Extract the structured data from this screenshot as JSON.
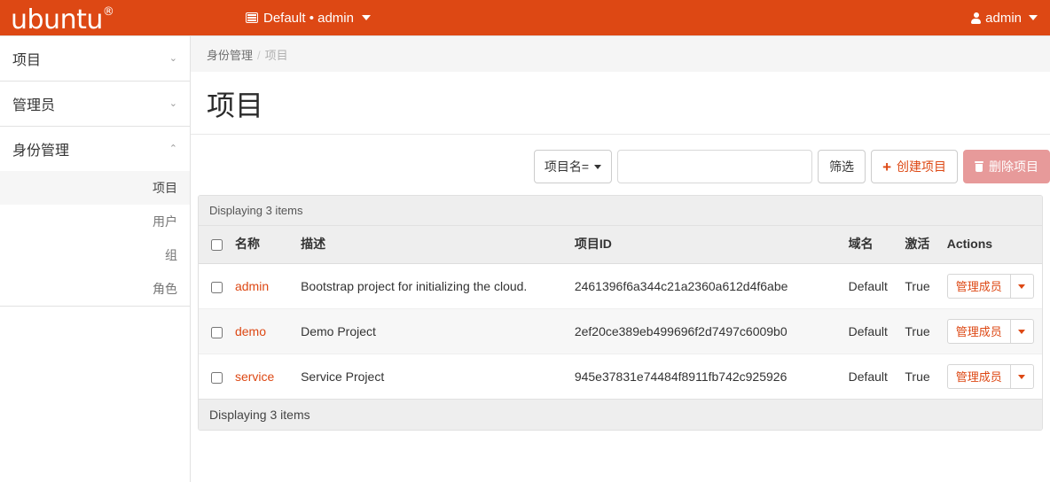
{
  "topbar": {
    "brand": "ubuntu",
    "brand_sup": "®",
    "context_icon": "grid-icon",
    "context_label": "Default • admin",
    "user_icon": "user-icon",
    "user_label": "admin",
    "bg_color": "#dd4814"
  },
  "sidebar": {
    "groups": [
      {
        "label": "项目",
        "chevron": "⌄",
        "expanded": false,
        "items": []
      },
      {
        "label": "管理员",
        "chevron": "⌄",
        "expanded": false,
        "items": []
      },
      {
        "label": "身份管理",
        "chevron": "⌃",
        "expanded": true,
        "items": [
          {
            "label": "项目",
            "active": true
          },
          {
            "label": "用户",
            "active": false
          },
          {
            "label": "组",
            "active": false
          },
          {
            "label": "角色",
            "active": false
          }
        ]
      }
    ]
  },
  "breadcrumb": {
    "parent": "身份管理",
    "separator": "/",
    "current": "项目"
  },
  "page": {
    "title": "项目"
  },
  "toolbar": {
    "filter_select_label": "项目名=",
    "filter_input_value": "",
    "filter_input_placeholder": "",
    "filter_button": "筛选",
    "create_button": "创建项目",
    "create_plus": "+",
    "delete_button": "删除项目",
    "delete_icon": "trash-icon",
    "create_color": "#dd4814",
    "delete_bg_color": "#e79a9a"
  },
  "table": {
    "header_count": "Displaying 3 items",
    "footer_count": "Displaying 3 items",
    "columns": [
      "名称",
      "描述",
      "项目ID",
      "域名",
      "激活",
      "Actions"
    ],
    "action_label": "管理成员",
    "rows": [
      {
        "name": "admin",
        "description": "Bootstrap project for initializing the cloud.",
        "project_id": "2461396f6a344c21a2360a612d4f6abe",
        "domain": "Default",
        "enabled": "True"
      },
      {
        "name": "demo",
        "description": "Demo Project",
        "project_id": "2ef20ce389eb499696f2d7497c6009b0",
        "domain": "Default",
        "enabled": "True"
      },
      {
        "name": "service",
        "description": "Service Project",
        "project_id": "945e37831e74484f8911fb742c925926",
        "domain": "Default",
        "enabled": "True"
      }
    ]
  }
}
